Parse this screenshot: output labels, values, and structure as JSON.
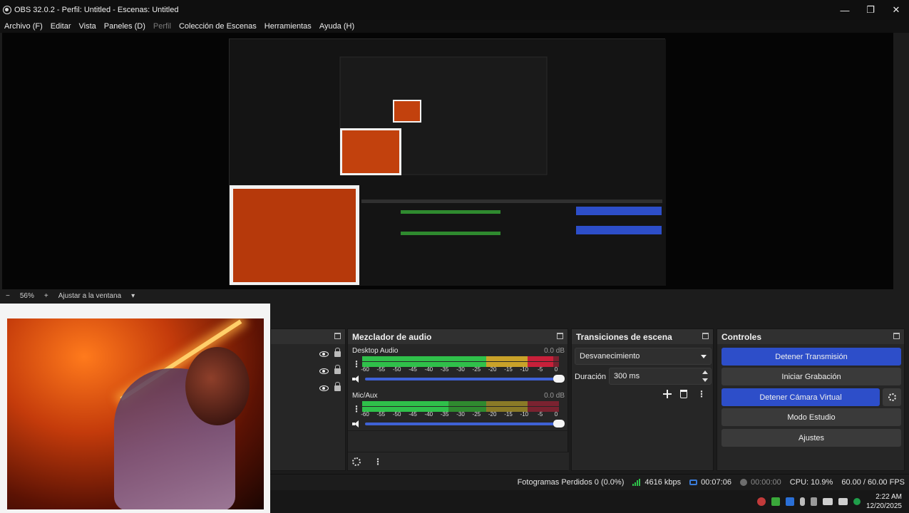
{
  "window": {
    "title": "OBS 32.0.2 - Perfil: Untitled - Escenas: Untitled",
    "minimize": "—",
    "maximize": "❐",
    "close": "✕"
  },
  "menu": [
    {
      "label": "Archivo (F)",
      "disabled": false
    },
    {
      "label": "Editar",
      "disabled": false
    },
    {
      "label": "Vista",
      "disabled": false
    },
    {
      "label": "Paneles (D)",
      "disabled": false
    },
    {
      "label": "Perfil",
      "disabled": true
    },
    {
      "label": "Colección de Escenas",
      "disabled": false
    },
    {
      "label": "Herramientas",
      "disabled": false
    },
    {
      "label": "Ayuda (H)",
      "disabled": false
    }
  ],
  "zoom": {
    "minus": "−",
    "value": "56%",
    "plus": "+",
    "fit_label": "Ajustar a la ventana",
    "dropdown": "▾"
  },
  "docks": {
    "mixer_title": "Mezclador de audio",
    "transitions_title": "Transiciones de escena",
    "controls_title": "Controles"
  },
  "mixer": {
    "channels": [
      {
        "name": "Desktop Audio",
        "db": "0.0 dB",
        "level": 0.97
      },
      {
        "name": "Mic/Aux",
        "db": "0.0 dB",
        "level": 0.44
      }
    ],
    "ticks": [
      "-60",
      "-55",
      "-50",
      "-45",
      "-40",
      "-35",
      "-30",
      "-25",
      "-20",
      "-15",
      "-10",
      "-5",
      "0"
    ]
  },
  "transitions": {
    "selected": "Desvanecimiento",
    "duration_label": "Duración",
    "duration_value": "300 ms"
  },
  "controls": {
    "stop_stream": "Detener Transmisión",
    "start_recording": "Iniciar Grabación",
    "stop_virtual_cam": "Detener Cámara Virtual",
    "studio_mode": "Modo Estudio",
    "settings": "Ajustes"
  },
  "status": {
    "dropped_frames": "Fotogramas Perdidos 0 (0.0%)",
    "bitrate": "4616 kbps",
    "stream_time": "00:07:06",
    "rec_time": "00:00:00",
    "cpu": "CPU: 10.9%",
    "fps": "60.00 / 60.00 FPS"
  },
  "clock": {
    "time": "2:22 AM",
    "date": "12/20/2025"
  },
  "colors": {
    "accent": "#2d4ec9",
    "meter_green": "#2fc04a",
    "meter_yellow": "#c9a229",
    "meter_red": "#c8203a"
  }
}
